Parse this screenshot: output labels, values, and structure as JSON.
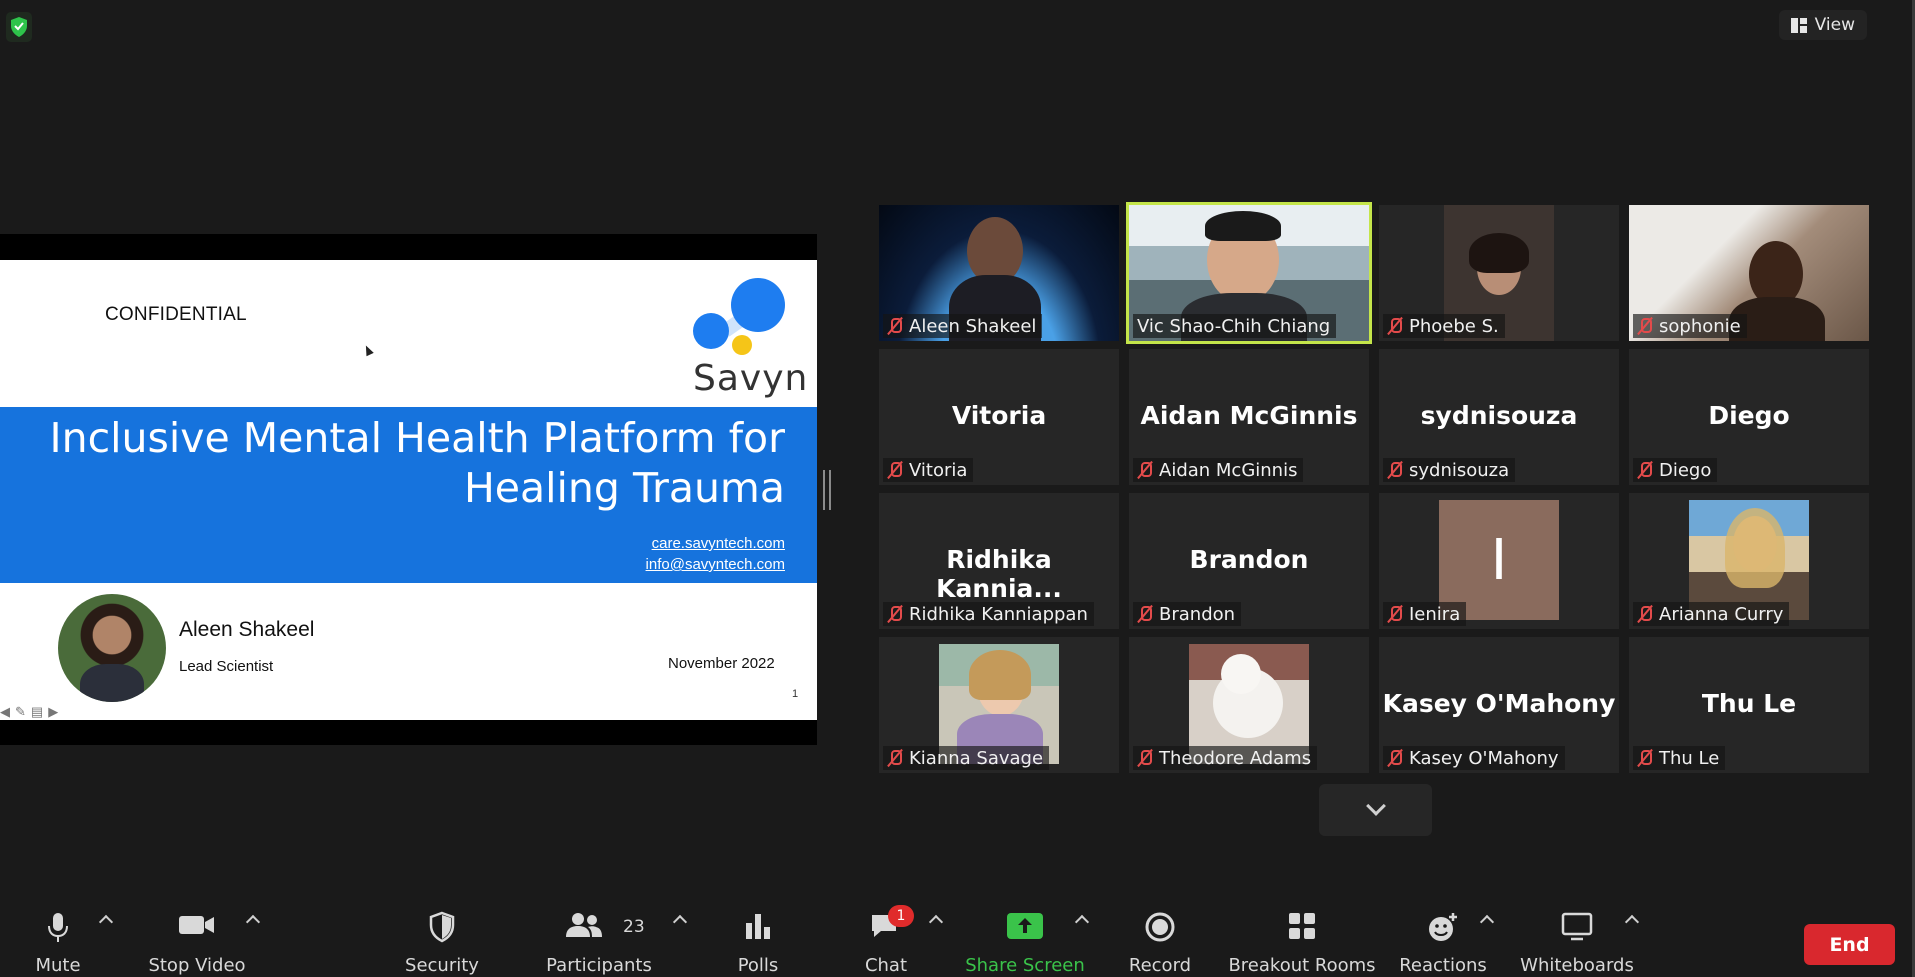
{
  "top_bar": {
    "view_label": "View"
  },
  "slide": {
    "confidential": "CONFIDENTIAL",
    "brand": "Savyn",
    "title_line1": "Inclusive Mental Health Platform for",
    "title_line2": "Healing Trauma",
    "link1": "care.savyntech.com",
    "link2": "info@savyntech.com",
    "presenter_name": "Aleen Shakeel",
    "presenter_role": "Lead Scientist",
    "date": "November 2022",
    "page_number": "1"
  },
  "participants": [
    {
      "name": "Aleen Shakeel",
      "display": "",
      "video": "space",
      "muted": true
    },
    {
      "name": "Vic Shao-Chih Chiang",
      "display": "",
      "video": "office",
      "muted": false,
      "active_speaker": true
    },
    {
      "name": "Phoebe S.",
      "display": "",
      "video": "room",
      "muted": true
    },
    {
      "name": "sophonie",
      "display": "",
      "video": "bright",
      "muted": true
    },
    {
      "name": "Vitoria",
      "display": "Vitoria",
      "video": "none",
      "muted": true
    },
    {
      "name": "Aidan McGinnis",
      "display": "Aidan McGinnis",
      "video": "none",
      "muted": true
    },
    {
      "name": "sydnisouza",
      "display": "sydnisouza",
      "video": "none",
      "muted": true
    },
    {
      "name": "Diego",
      "display": "Diego",
      "video": "none",
      "muted": true
    },
    {
      "name": "Ridhika Kanniappan",
      "display": "Ridhika  Kannia...",
      "video": "none",
      "muted": true
    },
    {
      "name": "Brandon",
      "display": "Brandon",
      "video": "none",
      "muted": true
    },
    {
      "name": "Ienira",
      "display": "",
      "initial": "I",
      "video": "initial",
      "muted": true
    },
    {
      "name": "Arianna Curry",
      "display": "",
      "video": "photo",
      "muted": true
    },
    {
      "name": "Kianna Savage",
      "display": "",
      "video": "photo",
      "muted": true
    },
    {
      "name": "Theodore Adams",
      "display": "",
      "video": "photo",
      "muted": true
    },
    {
      "name": "Kasey O'Mahony",
      "display": "Kasey O'Mahony",
      "video": "none",
      "muted": true
    },
    {
      "name": "Thu Le",
      "display": "Thu Le",
      "video": "none",
      "muted": true
    }
  ],
  "toolbar": {
    "mute": "Mute",
    "stop_video": "Stop Video",
    "security": "Security",
    "participants": "Participants",
    "participants_count": "23",
    "polls": "Polls",
    "chat": "Chat",
    "chat_badge": "1",
    "share_screen": "Share Screen",
    "record": "Record",
    "breakout_rooms": "Breakout Rooms",
    "reactions": "Reactions",
    "whiteboards": "Whiteboards",
    "end": "End"
  },
  "colors": {
    "accent_green": "#3ac34a",
    "active_speaker": "#c4e54a",
    "end_red": "#d9282e",
    "slide_blue": "#1673dd",
    "muted_red": "#e34b4b"
  }
}
